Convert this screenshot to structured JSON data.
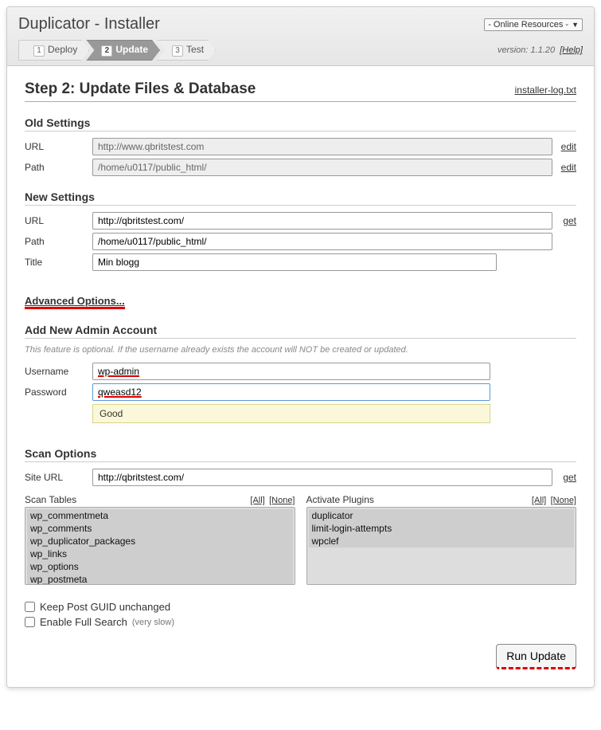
{
  "header": {
    "title": "Duplicator - Installer",
    "resources": "- Online Resources -",
    "version_label": "version:",
    "version": "1.1.20",
    "help": "[Help]"
  },
  "steps": {
    "s1num": "1",
    "s1": "Deploy",
    "s2num": "2",
    "s2": "Update",
    "s3num": "3",
    "s3": "Test"
  },
  "step_heading": "Step 2: Update Files & Database",
  "log_link": "installer-log.txt",
  "old": {
    "heading": "Old Settings",
    "url_label": "URL",
    "url_value": "http://www.qbritstest.com",
    "url_side": "edit",
    "path_label": "Path",
    "path_value": "/home/u0117/public_html/",
    "path_side": "edit"
  },
  "new": {
    "heading": "New Settings",
    "url_label": "URL",
    "url_value": "http://qbritstest.com/",
    "url_side": "get",
    "path_label": "Path",
    "path_value": "/home/u0117/public_html/",
    "title_label": "Title",
    "title_value": "Min blogg"
  },
  "advanced": "Advanced Options...",
  "admin": {
    "heading": "Add New Admin Account",
    "note": "This feature is optional. If the username already exists the account will NOT be created or updated.",
    "user_label": "Username",
    "user_value": "wp-admin",
    "pass_label": "Password",
    "pass_value": "qweasd12",
    "strength": "Good"
  },
  "scan": {
    "heading": "Scan Options",
    "url_label": "Site URL",
    "url_value": "http://qbritstest.com/",
    "url_side": "get",
    "tables_label": "Scan Tables",
    "plugins_label": "Activate Plugins",
    "all": "[All]",
    "none": "[None]",
    "tables": [
      "wp_commentmeta",
      "wp_comments",
      "wp_duplicator_packages",
      "wp_links",
      "wp_options",
      "wp_postmeta"
    ],
    "plugins": [
      "duplicator",
      "limit-login-attempts",
      "wpclef"
    ]
  },
  "cb": {
    "guid": "Keep Post GUID unchanged",
    "full": "Enable Full Search",
    "full_note": "(very slow)"
  },
  "run": "Run Update"
}
